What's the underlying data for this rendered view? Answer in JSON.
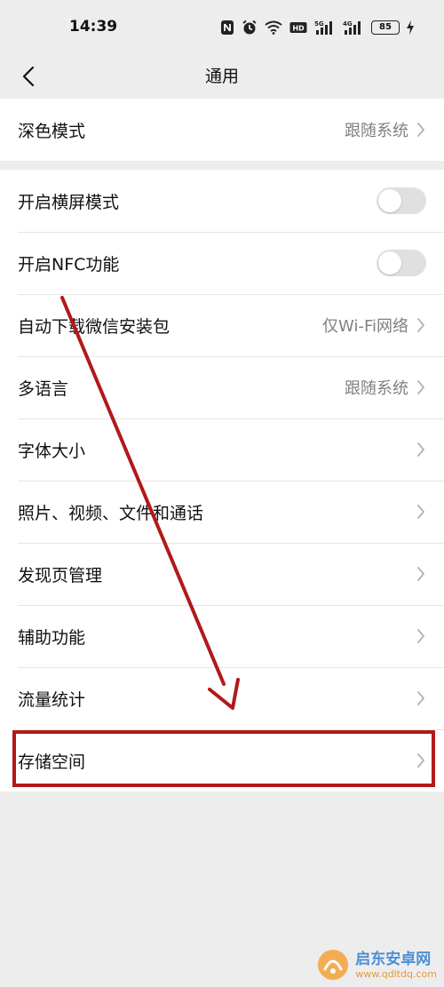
{
  "status_bar": {
    "time": "14:39",
    "battery": "85",
    "signal_1": "5G",
    "signal_2": "4G"
  },
  "nav": {
    "title": "通用"
  },
  "group1": [
    {
      "label": "深色模式",
      "value": "跟随系统"
    }
  ],
  "group2": [
    {
      "label": "开启横屏模式",
      "toggle": false
    },
    {
      "label": "开启NFC功能",
      "toggle": false
    },
    {
      "label": "自动下载微信安装包",
      "value": "仅Wi-Fi网络"
    },
    {
      "label": "多语言",
      "value": "跟随系统"
    },
    {
      "label": "字体大小"
    },
    {
      "label": "照片、视频、文件和通话"
    },
    {
      "label": "发现页管理"
    },
    {
      "label": "辅助功能"
    },
    {
      "label": "流量统计"
    },
    {
      "label": "存储空间"
    }
  ],
  "annotation": {
    "color": "#b01a1a",
    "highlighted_item": "存储空间"
  },
  "watermark": {
    "title": "启东安卓网",
    "url": "www.qdltdq.com"
  },
  "colors": {
    "background": "#ededed",
    "card": "#ffffff",
    "secondary_text": "#808080",
    "toggle_off": "#e0e0e0"
  }
}
